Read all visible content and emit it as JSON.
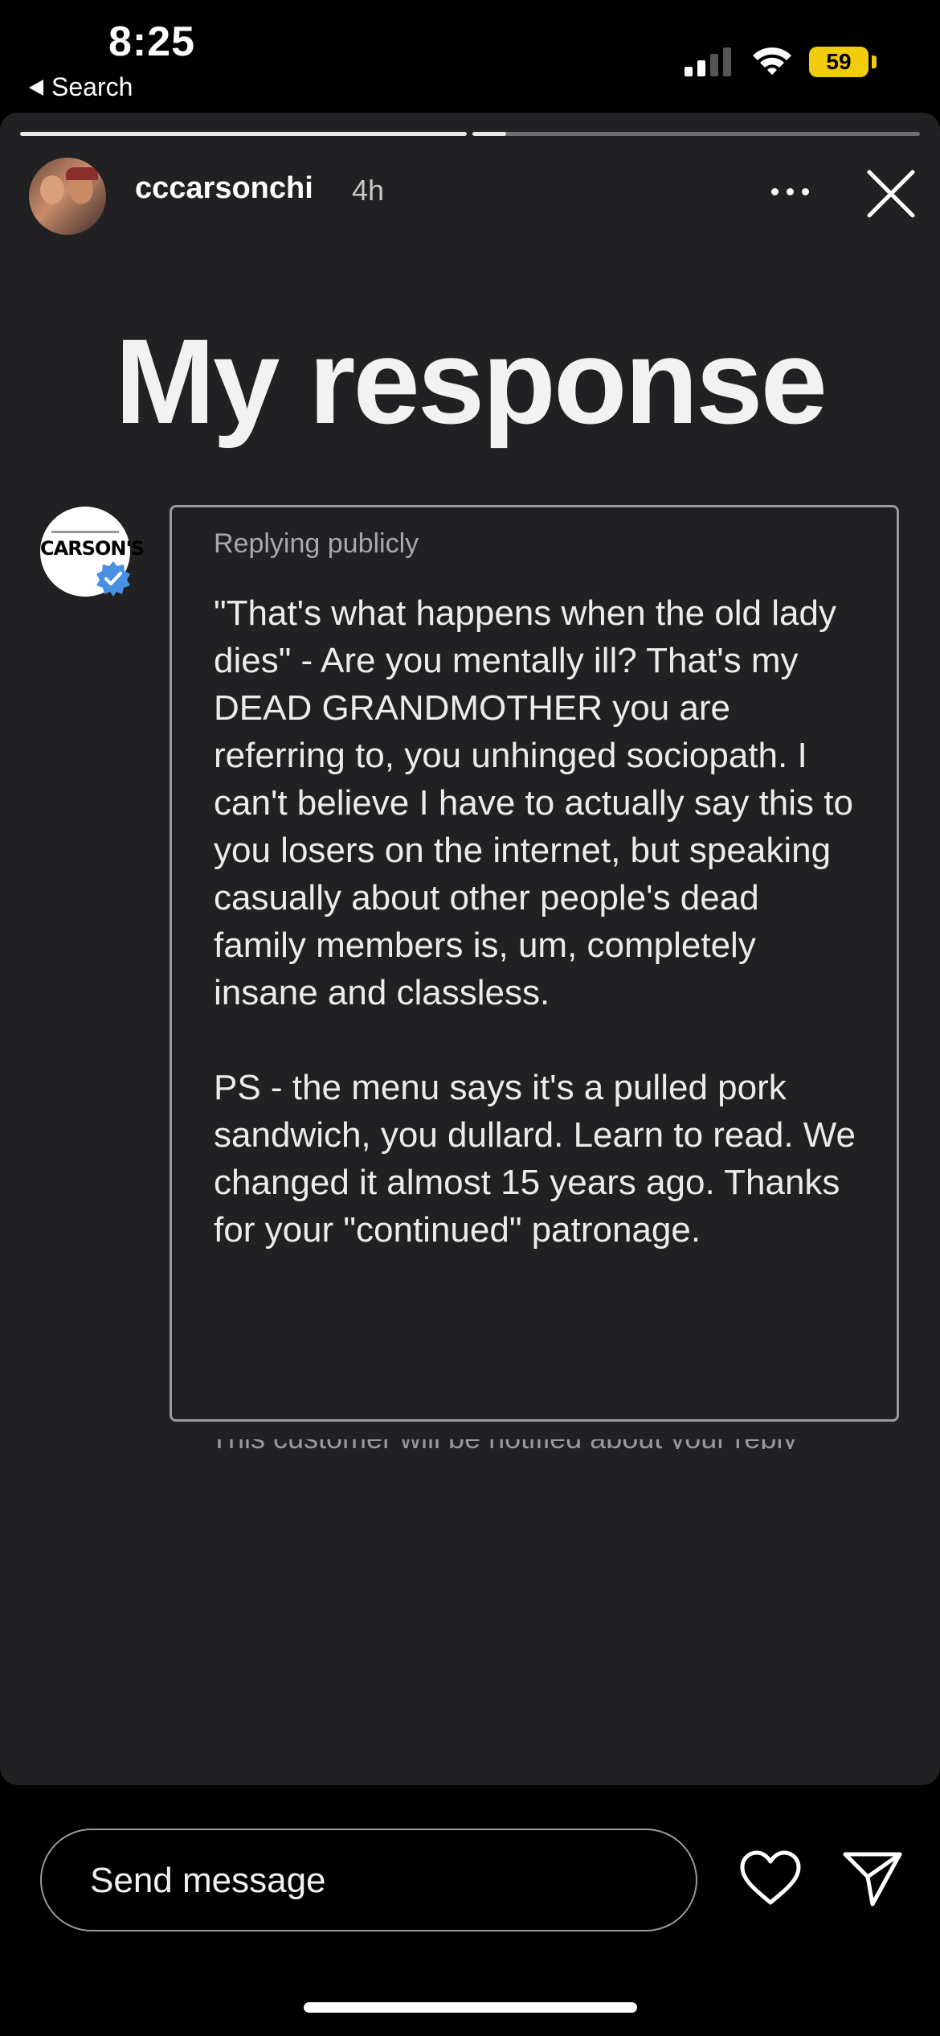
{
  "status_bar": {
    "time": "8:25",
    "back_label": "Search",
    "battery": "59",
    "battery_color": "#f2cc0c"
  },
  "story": {
    "username": "cccarsonchi",
    "age": "4h",
    "progress": [
      1.0,
      0.08
    ],
    "headline": "My response",
    "page_brand": "CARSON'S",
    "reply_label": "Replying publicly",
    "reply_text": "\"That's what happens when the old lady dies\" - Are you mentally ill? That's my DEAD GRANDMOTHER you are referring to, you unhinged sociopath. I can't believe I have to actually say this to you losers on the internet, but speaking casually about other people's dead family members is, um, completely insane and classless.\n\nPS - the menu says it's a pulled pork sandwich, you dullard. Learn to read. We changed it almost 15 years ago. Thanks for your \"continued\" patronage.",
    "cut_off_line": "This customer will be notified about your reply"
  },
  "footer": {
    "message_placeholder": "Send message"
  },
  "icons": {
    "more": "more-dots-icon",
    "close": "close-icon",
    "heart": "heart-icon",
    "send": "send-icon",
    "verified": "verified-badge-icon"
  }
}
